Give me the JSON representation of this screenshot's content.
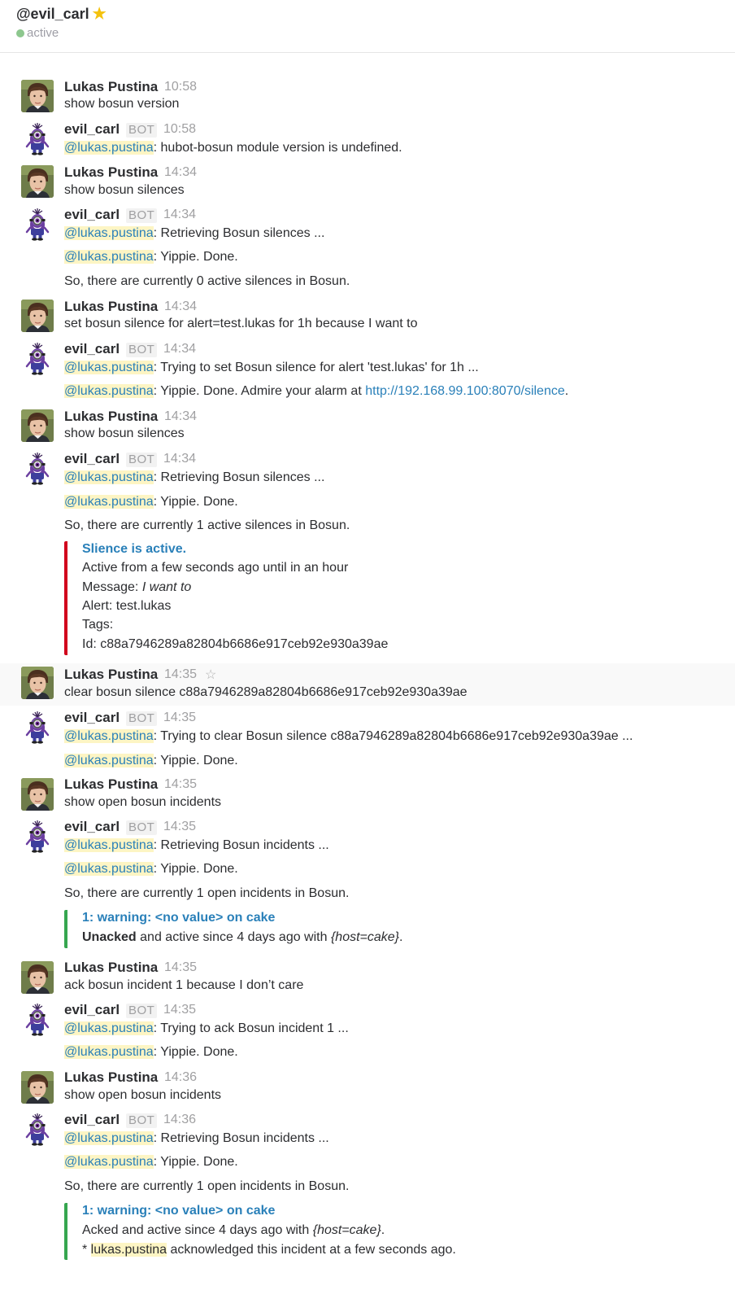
{
  "header": {
    "channel": "@evil_carl",
    "status": "active"
  },
  "users": {
    "human": "Lukas Pustina",
    "bot": "evil_carl",
    "bot_badge": "BOT",
    "mention": "@lukas.pustina"
  },
  "m1": {
    "time": "10:58",
    "text": "show bosun version"
  },
  "m2": {
    "time": "10:58",
    "l1": ": hubot-bosun module version is undefined."
  },
  "m3": {
    "time": "14:34",
    "text": "show bosun silences"
  },
  "m4": {
    "time": "14:34",
    "l1": ": Retrieving Bosun silences ...",
    "l2": ": Yippie. Done.",
    "l3": "So, there are currently 0 active silences in Bosun."
  },
  "m5": {
    "time": "14:34",
    "text": "set bosun silence for alert=test.lukas for 1h because I want to"
  },
  "m6": {
    "time": "14:34",
    "l1": ": Trying to set Bosun silence for alert 'test.lukas' for 1h ...",
    "l2": ": Yippie. Done. Admire your alarm at ",
    "link": "http://192.168.99.100:8070/silence",
    "l2_end": "."
  },
  "m7": {
    "time": "14:34",
    "text": "show bosun silences"
  },
  "m8": {
    "time": "14:34",
    "l1": ": Retrieving Bosun silences ...",
    "l2": ": Yippie. Done.",
    "l3": "So, there are currently 1 active silences in Bosun.",
    "attachment": {
      "title": "Slience is active.",
      "line1": "Active from a few seconds ago until in an hour",
      "msg_label": "Message: ",
      "msg_value": "I want to",
      "alert": "Alert: test.lukas",
      "tags": "Tags:",
      "id": "Id: c88a7946289a82804b6686e917ceb92e930a39ae"
    }
  },
  "m9": {
    "time": "14:35",
    "text": "clear bosun silence c88a7946289a82804b6686e917ceb92e930a39ae"
  },
  "m10": {
    "time": "14:35",
    "l1": ": Trying to clear Bosun silence c88a7946289a82804b6686e917ceb92e930a39ae ...",
    "l2": ": Yippie. Done."
  },
  "m11": {
    "time": "14:35",
    "text": "show open bosun incidents"
  },
  "m12": {
    "time": "14:35",
    "l1": ": Retrieving Bosun incidents ...",
    "l2": ": Yippie. Done.",
    "l3": "So, there are currently 1 open incidents in Bosun.",
    "attachment": {
      "title": "1: warning: <no value> on cake",
      "bold": "Unacked",
      "rest": " and active since 4 days ago with ",
      "tag": "{host=cake}",
      "end": "."
    }
  },
  "m13": {
    "time": "14:35",
    "text": "ack bosun incident 1 because I don’t care"
  },
  "m14": {
    "time": "14:35",
    "l1": ": Trying to ack Bosun incident 1 ...",
    "l2": ": Yippie. Done."
  },
  "m15": {
    "time": "14:36",
    "text": "show open bosun incidents"
  },
  "m16": {
    "time": "14:36",
    "l1": ": Retrieving Bosun incidents ...",
    "l2": ": Yippie. Done.",
    "l3": "So, there are currently 1 open incidents in Bosun.",
    "attachment": {
      "title": "1: warning: <no value> on cake",
      "line1": "Acked and active since 4 days ago with ",
      "tag": "{host=cake}",
      "end": ".",
      "line2_pre": "* ",
      "user": "lukas.pustina",
      "line2_post": " acknowledged this incident at a few seconds ago."
    }
  },
  "colors": {
    "link": "#2a80b9",
    "mention_bg": "#fdf5c4",
    "silence_bar": "#d1001c",
    "incident_bar": "#36a64f",
    "presence": "#8dc78e",
    "star": "#f4c20d"
  }
}
